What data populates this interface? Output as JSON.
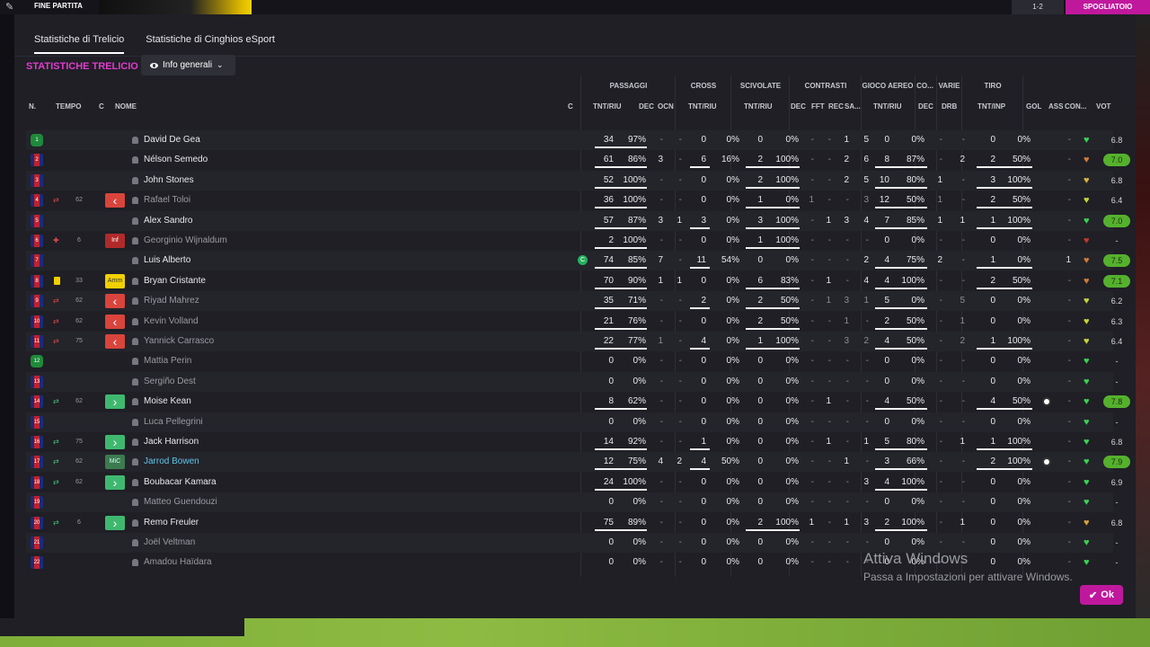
{
  "topbar": {
    "phase": "FINE PARTITA",
    "sub_button": "SPOGLIATOIO",
    "score_button": "1-2"
  },
  "tabs": [
    "Statistiche di Trelicio",
    "Statistiche di Cinghios eSport"
  ],
  "section_title": "STATISTICHE TRELICIO",
  "view_dropdown": "Info generali",
  "groups": {
    "passaggi": "PASSAGGI",
    "cross": "CROSS",
    "scivolate": "SCIVOLATE",
    "contrasti": "CONTRASTI",
    "gioco_aereo": "GIOCO AEREO",
    "co": "CO...",
    "varie": "VARIE",
    "tiro": "TIRO"
  },
  "columns": {
    "n": "N.",
    "tempo": "TEMPO",
    "c": "C",
    "nome": "NOME",
    "cap": "C",
    "pass_tnt": "TNT/RIU",
    "pass_dec": "DEC",
    "pass_ocn": "OCN",
    "cross_tnt": "TNT/RIU",
    "sciv_tnt": "TNT/RIU",
    "contr_dec": "DEC",
    "contr_fft": "FFT",
    "contr_rec": "REC",
    "contr_sa": "SA...",
    "aereo_tnt": "TNT/RIU",
    "co_dec": "DEC",
    "varie_drb": "DRB",
    "tiro_tnt": "TNT/INP",
    "gol": "GOL",
    "ass": "ASS",
    "con": "CON...",
    "vot": "VOT"
  },
  "players": [
    {
      "n": "1",
      "tempo": "",
      "name": "David De Gea",
      "pass": "34",
      "passp": "97%",
      "pdec": "-",
      "pocn": "-",
      "cross": "0",
      "crossp": "0%",
      "sciv": "0",
      "scivp": "0%",
      "cdec": "-",
      "cfft": "-",
      "crec": "1",
      "csa": "5",
      "aer": "0",
      "aerp": "0%",
      "codec": "-",
      "drb": "-",
      "tiro": "0",
      "tirop": "0%",
      "gol": "",
      "ass": "-",
      "vot": "6.8"
    },
    {
      "n": "2",
      "tempo": "",
      "name": "Nélson Semedo",
      "pass": "61",
      "passp": "86%",
      "pdec": "3",
      "pocn": "-",
      "cross": "6",
      "crossp": "16%",
      "sciv": "2",
      "scivp": "100%",
      "cdec": "-",
      "cfft": "-",
      "crec": "2",
      "csa": "6",
      "aer": "8",
      "aerp": "87%",
      "codec": "-",
      "drb": "2",
      "tiro": "2",
      "tirop": "50%",
      "gol": "",
      "ass": "-",
      "vot": "7.0"
    },
    {
      "n": "3",
      "tempo": "",
      "name": "John Stones",
      "pass": "52",
      "passp": "100%",
      "pdec": "-",
      "pocn": "-",
      "cross": "0",
      "crossp": "0%",
      "sciv": "2",
      "scivp": "100%",
      "cdec": "-",
      "cfft": "-",
      "crec": "2",
      "csa": "5",
      "aer": "10",
      "aerp": "80%",
      "codec": "1",
      "drb": "-",
      "tiro": "3",
      "tirop": "100%",
      "gol": "",
      "ass": "-",
      "vot": "6.8"
    },
    {
      "n": "4",
      "tempo": "62",
      "name": "Rafael Toloi",
      "pass": "36",
      "passp": "100%",
      "pdec": "-",
      "pocn": "-",
      "cross": "0",
      "crossp": "0%",
      "sciv": "1",
      "scivp": "0%",
      "cdec": "1",
      "cfft": "-",
      "crec": "-",
      "csa": "3",
      "aer": "12",
      "aerp": "50%",
      "codec": "1",
      "drb": "-",
      "tiro": "2",
      "tirop": "50%",
      "gol": "",
      "ass": "-",
      "vot": "6.4"
    },
    {
      "n": "5",
      "tempo": "",
      "name": "Alex Sandro",
      "pass": "57",
      "passp": "87%",
      "pdec": "3",
      "pocn": "1",
      "cross": "3",
      "crossp": "0%",
      "sciv": "3",
      "scivp": "100%",
      "cdec": "-",
      "cfft": "1",
      "crec": "3",
      "csa": "4",
      "aer": "7",
      "aerp": "85%",
      "codec": "1",
      "drb": "1",
      "tiro": "1",
      "tirop": "100%",
      "gol": "",
      "ass": "-",
      "vot": "7.0"
    },
    {
      "n": "6",
      "tempo": "6",
      "name": "Georginio Wijnaldum",
      "pass": "2",
      "passp": "100%",
      "pdec": "-",
      "pocn": "-",
      "cross": "0",
      "crossp": "0%",
      "sciv": "1",
      "scivp": "100%",
      "cdec": "-",
      "cfft": "-",
      "crec": "-",
      "csa": "-",
      "aer": "0",
      "aerp": "0%",
      "codec": "-",
      "drb": "-",
      "tiro": "0",
      "tirop": "0%",
      "gol": "",
      "ass": "-",
      "vot": "-"
    },
    {
      "n": "7",
      "tempo": "",
      "name": "Luis Alberto",
      "pass": "74",
      "passp": "85%",
      "pdec": "7",
      "pocn": "-",
      "cross": "11",
      "crossp": "54%",
      "sciv": "0",
      "scivp": "0%",
      "cdec": "-",
      "cfft": "-",
      "crec": "-",
      "csa": "2",
      "aer": "4",
      "aerp": "75%",
      "codec": "2",
      "drb": "-",
      "tiro": "1",
      "tirop": "0%",
      "gol": "",
      "ass": "1",
      "vot": "7.5"
    },
    {
      "n": "8",
      "tempo": "33",
      "name": "Bryan Cristante",
      "pass": "70",
      "passp": "90%",
      "pdec": "1",
      "pocn": "1",
      "cross": "0",
      "crossp": "0%",
      "sciv": "6",
      "scivp": "83%",
      "cdec": "-",
      "cfft": "1",
      "crec": "-",
      "csa": "4",
      "aer": "4",
      "aerp": "100%",
      "codec": "-",
      "drb": "-",
      "tiro": "2",
      "tirop": "50%",
      "gol": "",
      "ass": "-",
      "vot": "7.1"
    },
    {
      "n": "9",
      "tempo": "62",
      "name": "Riyad Mahrez",
      "pass": "35",
      "passp": "71%",
      "pdec": "-",
      "pocn": "-",
      "cross": "2",
      "crossp": "0%",
      "sciv": "2",
      "scivp": "50%",
      "cdec": "-",
      "cfft": "1",
      "crec": "3",
      "csa": "1",
      "aer": "5",
      "aerp": "0%",
      "codec": "-",
      "drb": "5",
      "tiro": "0",
      "tirop": "0%",
      "gol": "",
      "ass": "-",
      "vot": "6.2"
    },
    {
      "n": "10",
      "tempo": "62",
      "name": "Kevin Volland",
      "pass": "21",
      "passp": "76%",
      "pdec": "-",
      "pocn": "-",
      "cross": "0",
      "crossp": "0%",
      "sciv": "2",
      "scivp": "50%",
      "cdec": "-",
      "cfft": "-",
      "crec": "1",
      "csa": "-",
      "aer": "2",
      "aerp": "50%",
      "codec": "-",
      "drb": "1",
      "tiro": "0",
      "tirop": "0%",
      "gol": "",
      "ass": "-",
      "vot": "6.3"
    },
    {
      "n": "11",
      "tempo": "75",
      "name": "Yannick Carrasco",
      "pass": "22",
      "passp": "77%",
      "pdec": "1",
      "pocn": "-",
      "cross": "4",
      "crossp": "0%",
      "sciv": "1",
      "scivp": "100%",
      "cdec": "-",
      "cfft": "-",
      "crec": "3",
      "csa": "2",
      "aer": "4",
      "aerp": "50%",
      "codec": "-",
      "drb": "2",
      "tiro": "1",
      "tirop": "100%",
      "gol": "",
      "ass": "-",
      "vot": "6.4"
    },
    {
      "n": "12",
      "tempo": "",
      "name": "Mattia Perin",
      "pass": "0",
      "passp": "0%",
      "pdec": "-",
      "pocn": "-",
      "cross": "0",
      "crossp": "0%",
      "sciv": "0",
      "scivp": "0%",
      "cdec": "-",
      "cfft": "-",
      "crec": "-",
      "csa": "-",
      "aer": "0",
      "aerp": "0%",
      "codec": "-",
      "drb": "-",
      "tiro": "0",
      "tirop": "0%",
      "gol": "",
      "ass": "-",
      "vot": "-"
    },
    {
      "n": "13",
      "tempo": "",
      "name": "Sergiño Dest",
      "pass": "0",
      "passp": "0%",
      "pdec": "-",
      "pocn": "-",
      "cross": "0",
      "crossp": "0%",
      "sciv": "0",
      "scivp": "0%",
      "cdec": "-",
      "cfft": "-",
      "crec": "-",
      "csa": "-",
      "aer": "0",
      "aerp": "0%",
      "codec": "-",
      "drb": "-",
      "tiro": "0",
      "tirop": "0%",
      "gol": "",
      "ass": "-",
      "vot": "-"
    },
    {
      "n": "14",
      "tempo": "62",
      "name": "Moise Kean",
      "pass": "8",
      "passp": "62%",
      "pdec": "-",
      "pocn": "-",
      "cross": "0",
      "crossp": "0%",
      "sciv": "0",
      "scivp": "0%",
      "cdec": "-",
      "cfft": "1",
      "crec": "-",
      "csa": "-",
      "aer": "4",
      "aerp": "50%",
      "codec": "-",
      "drb": "-",
      "tiro": "4",
      "tirop": "50%",
      "gol": "1",
      "ass": "-",
      "vot": "7.8"
    },
    {
      "n": "15",
      "tempo": "",
      "name": "Luca Pellegrini",
      "pass": "0",
      "passp": "0%",
      "pdec": "-",
      "pocn": "-",
      "cross": "0",
      "crossp": "0%",
      "sciv": "0",
      "scivp": "0%",
      "cdec": "-",
      "cfft": "-",
      "crec": "-",
      "csa": "-",
      "aer": "0",
      "aerp": "0%",
      "codec": "-",
      "drb": "-",
      "tiro": "0",
      "tirop": "0%",
      "gol": "",
      "ass": "-",
      "vot": "-"
    },
    {
      "n": "16",
      "tempo": "75",
      "name": "Jack Harrison",
      "pass": "14",
      "passp": "92%",
      "pdec": "-",
      "pocn": "-",
      "cross": "1",
      "crossp": "0%",
      "sciv": "0",
      "scivp": "0%",
      "cdec": "-",
      "cfft": "1",
      "crec": "-",
      "csa": "1",
      "aer": "5",
      "aerp": "80%",
      "codec": "-",
      "drb": "1",
      "tiro": "1",
      "tirop": "100%",
      "gol": "",
      "ass": "-",
      "vot": "6.8"
    },
    {
      "n": "17",
      "tempo": "62",
      "name": "Jarrod Bowen",
      "pass": "12",
      "passp": "75%",
      "pdec": "4",
      "pocn": "2",
      "cross": "4",
      "crossp": "50%",
      "sciv": "0",
      "scivp": "0%",
      "cdec": "-",
      "cfft": "-",
      "crec": "1",
      "csa": "-",
      "aer": "3",
      "aerp": "66%",
      "codec": "-",
      "drb": "-",
      "tiro": "2",
      "tirop": "100%",
      "gol": "1",
      "ass": "-",
      "vot": "7.9"
    },
    {
      "n": "18",
      "tempo": "62",
      "name": "Boubacar Kamara",
      "pass": "24",
      "passp": "100%",
      "pdec": "-",
      "pocn": "-",
      "cross": "0",
      "crossp": "0%",
      "sciv": "0",
      "scivp": "0%",
      "cdec": "-",
      "cfft": "-",
      "crec": "-",
      "csa": "3",
      "aer": "4",
      "aerp": "100%",
      "codec": "-",
      "drb": "-",
      "tiro": "0",
      "tirop": "0%",
      "gol": "",
      "ass": "-",
      "vot": "6.9"
    },
    {
      "n": "19",
      "tempo": "",
      "name": "Matteo Guendouzi",
      "pass": "0",
      "passp": "0%",
      "pdec": "-",
      "pocn": "-",
      "cross": "0",
      "crossp": "0%",
      "sciv": "0",
      "scivp": "0%",
      "cdec": "-",
      "cfft": "-",
      "crec": "-",
      "csa": "-",
      "aer": "0",
      "aerp": "0%",
      "codec": "-",
      "drb": "-",
      "tiro": "0",
      "tirop": "0%",
      "gol": "",
      "ass": "-",
      "vot": "-"
    },
    {
      "n": "20",
      "tempo": "6",
      "name": "Remo Freuler",
      "pass": "75",
      "passp": "89%",
      "pdec": "-",
      "pocn": "-",
      "cross": "0",
      "crossp": "0%",
      "sciv": "2",
      "scivp": "100%",
      "cdec": "1",
      "cfft": "-",
      "crec": "1",
      "csa": "3",
      "aer": "2",
      "aerp": "100%",
      "codec": "-",
      "drb": "1",
      "tiro": "0",
      "tirop": "0%",
      "gol": "",
      "ass": "-",
      "vot": "6.8"
    },
    {
      "n": "21",
      "tempo": "",
      "name": "Joël Veltman",
      "pass": "0",
      "passp": "0%",
      "pdec": "-",
      "pocn": "-",
      "cross": "0",
      "crossp": "0%",
      "sciv": "0",
      "scivp": "0%",
      "cdec": "-",
      "cfft": "-",
      "crec": "-",
      "csa": "-",
      "aer": "0",
      "aerp": "0%",
      "codec": "-",
      "drb": "-",
      "tiro": "0",
      "tirop": "0%",
      "gol": "",
      "ass": "-",
      "vot": "-"
    },
    {
      "n": "22",
      "tempo": "",
      "name": "Amadou Haïdara",
      "pass": "0",
      "passp": "0%",
      "pdec": "-",
      "pocn": "-",
      "cross": "0",
      "crossp": "0%",
      "sciv": "0",
      "scivp": "0%",
      "cdec": "-",
      "cfft": "-",
      "crec": "-",
      "csa": "-",
      "aer": "0",
      "aerp": "0%",
      "codec": "-",
      "drb": "-",
      "tiro": "0",
      "tirop": "0%",
      "gol": "",
      "ass": "-",
      "vot": "-"
    }
  ],
  "role_badges": {
    "inf": "Inf",
    "amm": "Amm",
    "mic": "MiC"
  },
  "watermark": {
    "line1": "Attiva Windows",
    "line2": "Passa a Impostazioni per attivare Windows."
  },
  "ok_label": "Ok",
  "colors": {
    "accent": "#c0189d",
    "rating_green": "#55b12d",
    "title_pink": "#e23bd0"
  }
}
